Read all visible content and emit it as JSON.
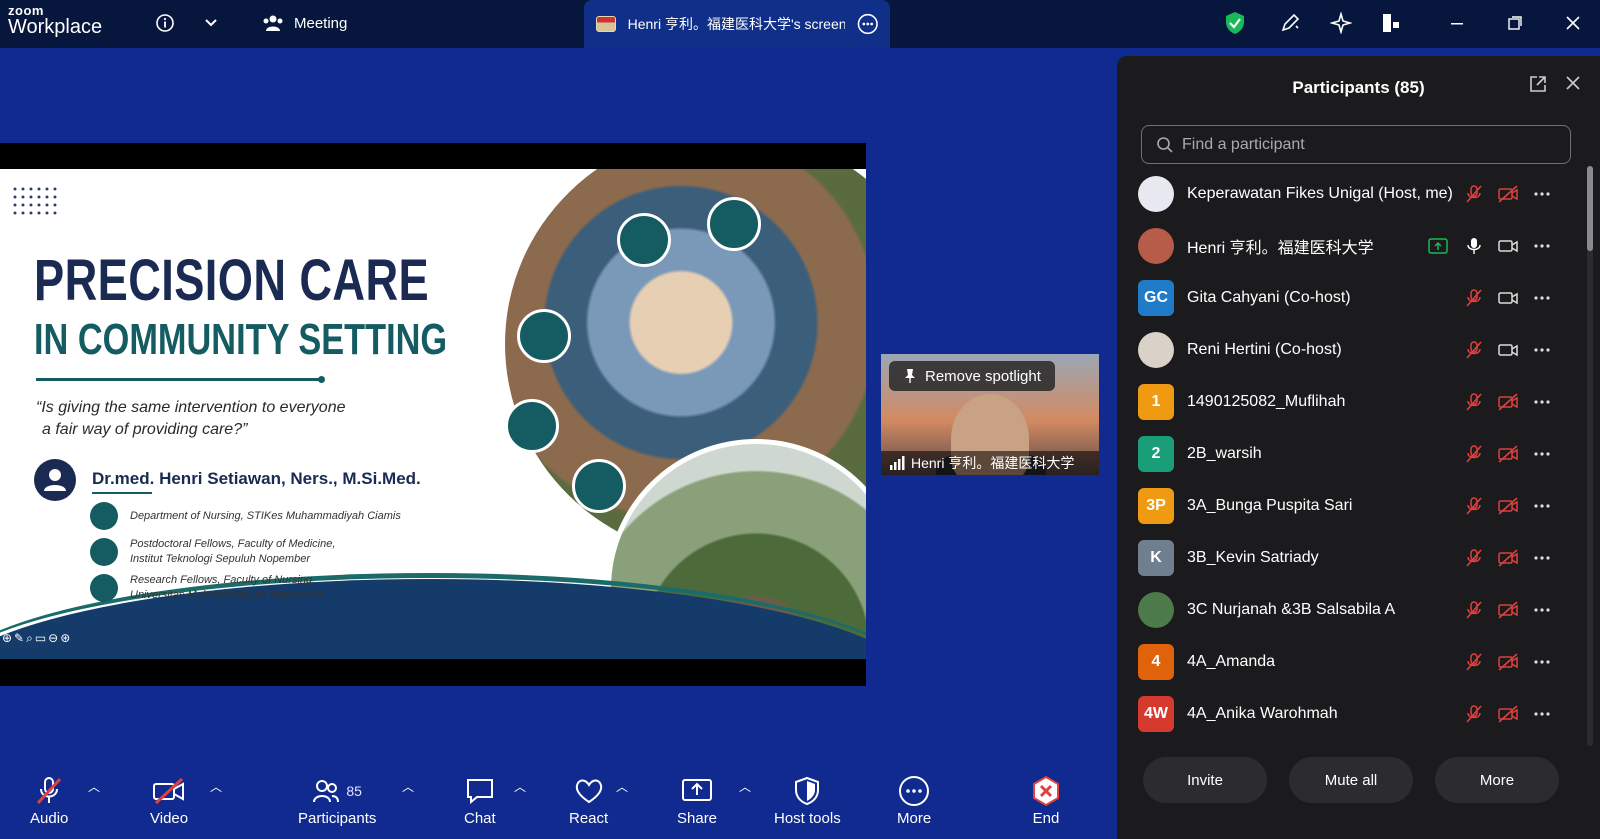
{
  "app": {
    "logo_top": "zoom",
    "logo_bottom": "Workplace"
  },
  "titlebar": {
    "meeting_label": "Meeting",
    "screen_tab_label": "Henri 亨利。福建医科大学's screen share",
    "icons": [
      "info-icon",
      "chevron-down-icon",
      "people-icon",
      "shield-check-icon",
      "pen-icon",
      "sparkle-icon",
      "apps-icon",
      "minimize-icon",
      "restore-icon",
      "close-icon"
    ]
  },
  "slide": {
    "title_line1": "PRECISION CARE",
    "title_line2": "IN COMMUNITY SETTING",
    "quote_line1": "“Is giving the same intervention to everyone",
    "quote_line2": "a fair way of providing care?”",
    "author": "Dr.med. Henri Setiawan, Ners., M.Si.Med.",
    "affiliations": [
      {
        "line1": "Department of Nursing, STIKes Muhammadiyah Ciamis",
        "line2": ""
      },
      {
        "line1": "Postdoctoral Fellows, Faculty of Medicine,",
        "line2": "Institut Teknologi Sepuluh Nopember"
      },
      {
        "line1": "Research Fellows, Faculty of Nursing,",
        "line2": "Universitas Muhammadiyah Yogyakarta"
      }
    ]
  },
  "spotlight": {
    "remove_label": "Remove spotlight",
    "name": "Henri 亨利。福建医科大学"
  },
  "toolbar": {
    "audio": "Audio",
    "video": "Video",
    "participants": "Participants",
    "participants_count": "85",
    "chat": "Chat",
    "react": "React",
    "share": "Share",
    "host_tools": "Host tools",
    "more": "More",
    "end": "End"
  },
  "panel": {
    "title": "Participants (85)",
    "search_placeholder": "Find a participant",
    "participants": [
      {
        "name": "Keperawatan Fikes Unigal (Host, me)",
        "avatar": "",
        "avatar_color": "#e8e8f0",
        "photo": true,
        "mic": "muted",
        "cam": "off"
      },
      {
        "name": "Henri 亨利。福建医科大学",
        "avatar": "",
        "avatar_color": "#b85c4a",
        "photo": true,
        "mic": "on",
        "cam": "on",
        "sharing": true
      },
      {
        "name": "Gita Cahyani (Co-host)",
        "avatar": "GC",
        "avatar_color": "#1f7ac7",
        "mic": "muted",
        "cam": "on"
      },
      {
        "name": "Reni Hertini (Co-host)",
        "avatar": "",
        "avatar_color": "#d8d2c8",
        "photo": true,
        "mic": "muted",
        "cam": "on"
      },
      {
        "name": "1490125082_Muflihah",
        "avatar": "1",
        "avatar_color": "#f09a12",
        "mic": "muted",
        "cam": "off"
      },
      {
        "name": "2B_warsih",
        "avatar": "2",
        "avatar_color": "#1a9e7a",
        "mic": "muted",
        "cam": "off"
      },
      {
        "name": "3A_Bunga Puspita Sari",
        "avatar": "3P",
        "avatar_color": "#f09a12",
        "mic": "muted",
        "cam": "off"
      },
      {
        "name": "3B_Kevin Satriady",
        "avatar": "K",
        "avatar_color": "#6f7f8f",
        "mic": "muted",
        "cam": "off"
      },
      {
        "name": "3C Nurjanah &3B Salsabila A",
        "avatar": "",
        "avatar_color": "#4d7a4a",
        "photo": true,
        "mic": "muted",
        "cam": "off"
      },
      {
        "name": "4A_Amanda",
        "avatar": "4",
        "avatar_color": "#e0620a",
        "mic": "muted",
        "cam": "off"
      },
      {
        "name": "4A_Anika Warohmah",
        "avatar": "4W",
        "avatar_color": "#d63a2e",
        "mic": "muted",
        "cam": "off"
      },
      {
        "name": "",
        "avatar": "",
        "avatar_color": "#1a9e7a",
        "mic": "muted",
        "cam": "off"
      }
    ],
    "buttons": {
      "invite": "Invite",
      "mute_all": "Mute all",
      "more": "More"
    }
  },
  "colors": {
    "stage_bg": "#112a8f",
    "titlebar_bg": "#07163d",
    "panel_bg": "#1b1b1d",
    "muted_red": "#e0413e",
    "end_red": "#e0413e"
  }
}
